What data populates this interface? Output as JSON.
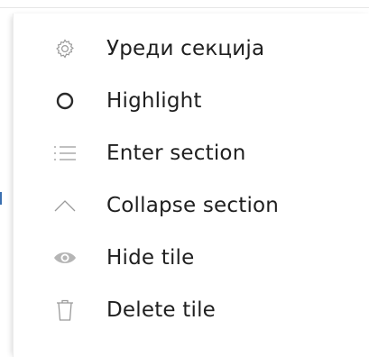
{
  "menu": {
    "items": [
      {
        "label": "Уреди секција",
        "icon": "gear-icon"
      },
      {
        "label": "Highlight",
        "icon": "circle-icon"
      },
      {
        "label": "Enter section",
        "icon": "list-icon"
      },
      {
        "label": "Collapse section",
        "icon": "chevron-up-icon"
      },
      {
        "label": "Hide tile",
        "icon": "eye-icon"
      },
      {
        "label": "Delete tile",
        "icon": "trash-icon"
      }
    ]
  },
  "colors": {
    "text": "#1f1f1f",
    "icon": "#9a9a9a",
    "accent": "#3a6fb0"
  }
}
